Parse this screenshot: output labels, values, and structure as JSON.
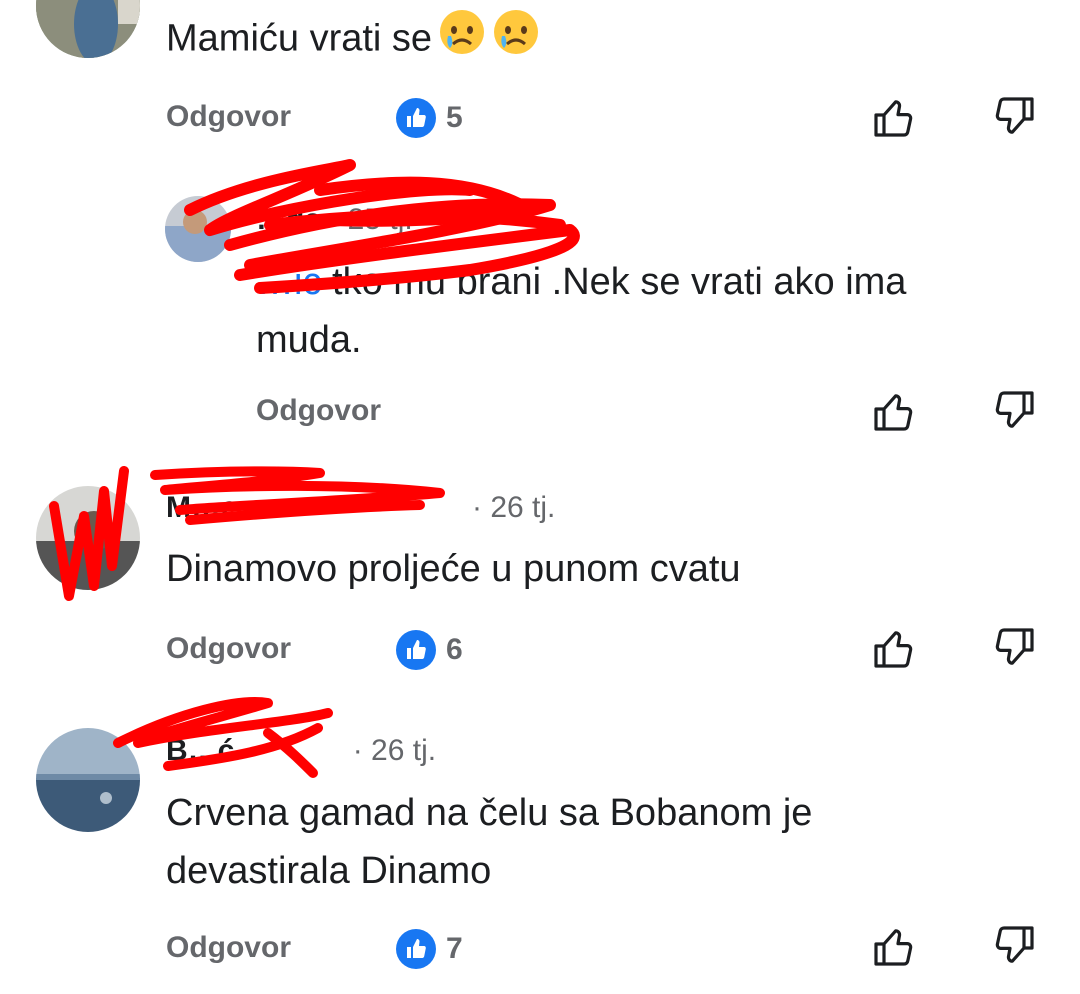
{
  "colors": {
    "accent": "#1877f2",
    "muted": "#65676b",
    "text": "#1c1e21",
    "redaction": "#ff0000"
  },
  "comments": [
    {
      "author": "",
      "time": "",
      "text": "Mamiću vrati se",
      "emojis": [
        "crying-face-emoji",
        "crying-face-emoji"
      ],
      "reply_label": "Odgovor",
      "likes": "5"
    },
    {
      "author": "…da",
      "time": "· 25 tj.",
      "mention": "…ic",
      "text": " tko mu brani .Nek se vrati ako ima muda.",
      "reply_label": "Odgovor"
    },
    {
      "author": "M…c",
      "time": "· 26 tj.",
      "text": "Dinamovo proljeće u punom cvatu",
      "reply_label": "Odgovor",
      "likes": "6"
    },
    {
      "author": "B…ć",
      "time": "· 26 tj.",
      "text": "Crvena gamad na čelu sa Bobanom je devastirala Dinamo",
      "reply_label": "Odgovor",
      "likes": "7"
    }
  ],
  "icons": {
    "like": "thumbs-up-icon",
    "dislike": "thumbs-down-icon",
    "reaction": "like-reaction-icon"
  }
}
